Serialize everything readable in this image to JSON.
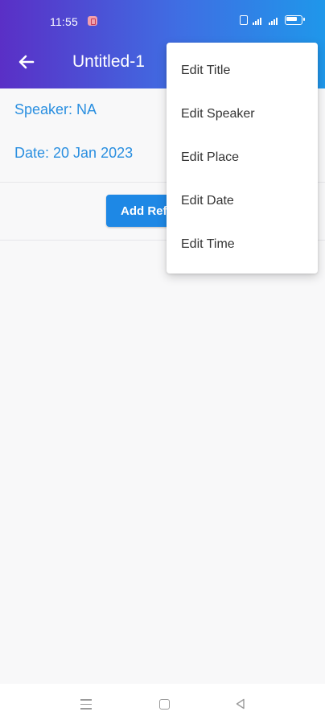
{
  "status_bar": {
    "time": "11:55"
  },
  "app_bar": {
    "title": "Untitled-1",
    "back_icon": "arrow-left-icon"
  },
  "details": {
    "speaker": "Speaker: NA",
    "date": "Date: 20 Jan 2023"
  },
  "add_button": {
    "label": "Add Ref"
  },
  "menu": {
    "items": [
      {
        "label": "Edit Title"
      },
      {
        "label": "Edit Speaker"
      },
      {
        "label": "Edit Place"
      },
      {
        "label": "Edit Date"
      },
      {
        "label": "Edit Time"
      }
    ]
  },
  "nav": {
    "icons": [
      "menu-icon",
      "home-icon",
      "back-triangle-icon"
    ]
  },
  "colors": {
    "gradient_start": "#5a2fc6",
    "gradient_end": "#1f97ea",
    "accent": "#1e88e5",
    "link_text": "#2a8fe0"
  }
}
